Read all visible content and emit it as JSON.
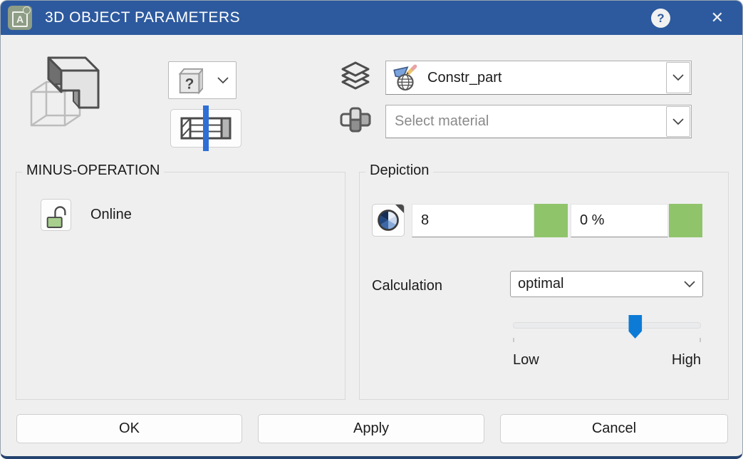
{
  "colors": {
    "titlebar": "#2d5a9e",
    "accent_green": "#90c46b",
    "accent_blue": "#0d7bd6",
    "background": "#efefef"
  },
  "titlebar": {
    "title": "3D OBJECT PARAMETERS",
    "app_icon_letter": "A",
    "help_glyph": "?",
    "close_glyph": "✕"
  },
  "object_row": {
    "preview_icon": "minus-operation-cubes",
    "type_dropdown": {
      "icon": "unknown-object-box",
      "glyph": "?"
    },
    "section_button_icon": "cross-section-beam",
    "layer_field": {
      "icon": "layer-edit-globe",
      "value": "Constr_part"
    },
    "material_field": {
      "icon": "material-connector",
      "placeholder": "Select material"
    }
  },
  "minus_operation": {
    "label": "MINUS-OPERATION",
    "lock_icon": "padlock-open",
    "status_label": "Online"
  },
  "depiction": {
    "label": "Depiction",
    "facets_button_icon": "pie-segments",
    "facets_value": "8",
    "transparency_value": "0 %",
    "calculation_label": "Calculation",
    "calculation_value": "optimal",
    "slider": {
      "low_label": "Low",
      "high_label": "High",
      "thumb_left": "65%"
    }
  },
  "footer": {
    "ok_label": "OK",
    "apply_label": "Apply",
    "cancel_label": "Cancel"
  }
}
